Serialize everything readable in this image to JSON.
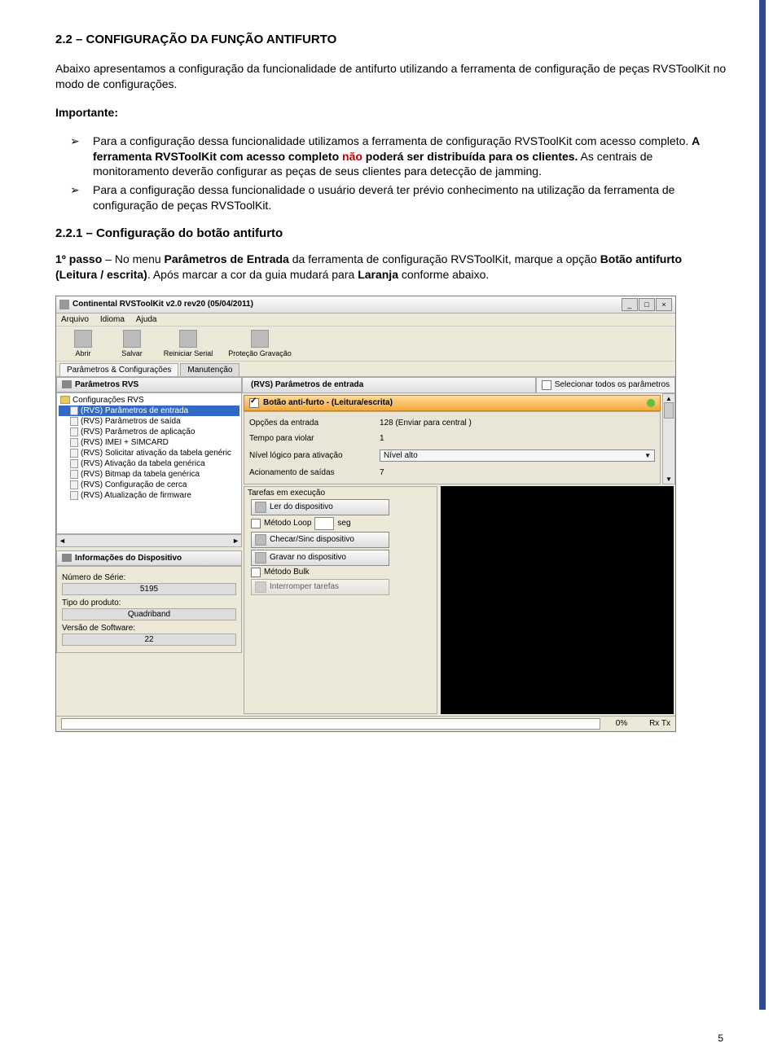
{
  "doc": {
    "heading": "2.2 – CONFIGURAÇÃO DA FUNÇÃO ANTIFURTO",
    "intro": "Abaixo apresentamos a configuração da funcionalidade de antifurto utilizando a ferramenta de configuração de peças RVSToolKit no modo de configurações.",
    "importante_label": "Importante:",
    "bullet1a": "Para a configuração dessa funcionalidade utilizamos a ferramenta de configuração RVSToolKit com acesso completo. ",
    "bullet1b": "A ferramenta RVSToolKit com acesso completo ",
    "bullet1_nao": "não",
    "bullet1c": " poderá ser distribuída para os clientes.",
    "bullet1d": " As centrais de monitoramento deverão configurar as peças de seus clientes para detecção de jamming.",
    "bullet2": "Para a configuração dessa funcionalidade o usuário deverá ter prévio conhecimento na utilização da ferramenta de configuração de peças RVSToolKit.",
    "sub": "2.2.1 – Configuração do botão antifurto",
    "p1a": "1º passo",
    "p1b": " – No menu ",
    "p1c": "Parâmetros de Entrada",
    "p1d": " da ferramenta de configuração RVSToolKit, marque a opção ",
    "p1e": "Botão antifurto (Leitura / escrita)",
    "p1f": ". Após marcar a cor da guia mudará para ",
    "p1g": "Laranja",
    "p1h": " conforme abaixo.",
    "pagenum": "5"
  },
  "app": {
    "title": "Continental RVSToolKit v2.0 rev20 (05/04/2011)",
    "menu": [
      "Arquivo",
      "Idioma",
      "Ajuda"
    ],
    "toolbar": [
      "Abrir",
      "Salvar",
      "Reiniciar Serial",
      "Proteção Gravação"
    ],
    "tabs": [
      "Parâmetros & Configurações",
      "Manutenção"
    ],
    "win": {
      "min": "_",
      "max": "□",
      "close": "×"
    },
    "left": {
      "hdr1": "Parâmetros RVS",
      "root": "Configurações RVS",
      "items": [
        "(RVS) Parâmetros de entrada",
        "(RVS) Parâmetros de saída",
        "(RVS) Parâmetros de aplicação",
        "(RVS) IMEI + SIMCARD",
        "(RVS) Solicitar ativação da tabela genéric",
        "(RVS) Ativação da tabela genérica",
        "(RVS) Bitmap da tabela genérica",
        "(RVS) Configuração de cerca",
        "(RVS) Atualização de firmware"
      ],
      "scroll": {
        "l": "◄",
        "r": "►"
      },
      "hdr2": "Informações do Dispositivo",
      "serie_l": "Número de Série:",
      "serie_v": "5195",
      "tipo_l": "Tipo do produto:",
      "tipo_v": "Quadriband",
      "ver_l": "Versão de Software:",
      "ver_v": "22"
    },
    "right": {
      "hdr": "(RVS) Parâmetros de entrada",
      "selall": "Selecionar todos os parâmetros",
      "orange": "Botão anti-furto - (Leitura/escrita)",
      "rows": [
        {
          "l": "Opções da entrada",
          "v": "128 (Enviar para central )"
        },
        {
          "l": "Tempo para violar",
          "v": "1"
        },
        {
          "l": "Nível lógico para ativação",
          "v": "Nível alto",
          "dd": true
        },
        {
          "l": "Acionamento de saídas",
          "v": "7"
        }
      ],
      "vscroll": {
        "up": "▲",
        "dn": "▼"
      },
      "tasks": {
        "title": "Tarefas em execução",
        "b1": "Ler do dispositivo",
        "loop": "Método Loop",
        "seg": "seg",
        "b2": "Checar/Sinc dispositivo",
        "b3": "Gravar no dispositivo",
        "bulk": "Método Bulk",
        "b4": "Interromper tarefas"
      }
    },
    "status": {
      "pct": "0%",
      "rx": "Rx Tx"
    }
  }
}
